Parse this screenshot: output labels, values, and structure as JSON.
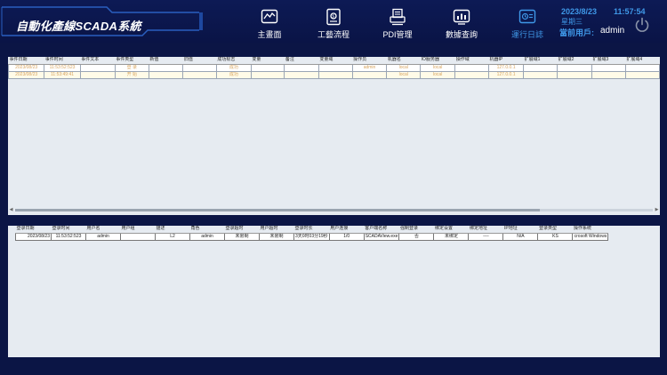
{
  "app": {
    "title": "自動化產線SCADA系統"
  },
  "nav": [
    {
      "label": "主畫面",
      "icon": "chart-monitor-icon"
    },
    {
      "label": "工藝流程",
      "icon": "process-flow-icon"
    },
    {
      "label": "PDI管理",
      "icon": "pdi-printer-icon"
    },
    {
      "label": "數據查詢",
      "icon": "data-query-icon"
    },
    {
      "label": "運行日誌",
      "icon": "operation-log-icon"
    }
  ],
  "status": {
    "date": "2023/8/23",
    "time": "11:57:54",
    "weekday": "星期三",
    "user_label": "當前用戶:",
    "user_name": "admin"
  },
  "colors": {
    "accent": "#3f98e8",
    "header_bg": "#0d1a55",
    "panel_bg": "#e6ebf1",
    "event_text": "#d8a560"
  },
  "event_table": {
    "columns": [
      "事件日期",
      "事件时间",
      "事件文本",
      "事件类型",
      "新值",
      "旧值",
      "成功标志",
      "变量",
      "备注",
      "变量域",
      "操作员",
      "机器名",
      "IO服务器",
      "操作域",
      "机器IP",
      "扩展域1",
      "扩展域2",
      "扩展域3",
      "扩展域4"
    ],
    "rows": [
      [
        "2023/08/23",
        "11:53:52:523",
        "",
        "登 录",
        "",
        "",
        "成功",
        "",
        "",
        "",
        "admin",
        "local",
        "local",
        "",
        "127.0.0.1",
        "",
        "",
        "",
        ""
      ],
      [
        "2023/08/23",
        "11:53:49:41",
        "",
        "开 始",
        "",
        "",
        "成功",
        "",
        "",
        "",
        "",
        "local",
        "local",
        "",
        "127.0.0.1",
        "",
        "",
        "",
        ""
      ]
    ]
  },
  "login_table": {
    "columns": [
      "登录日期",
      "登录时间",
      "用户名",
      "用户组",
      "描述",
      "角色",
      "登录超时",
      "用户超时",
      "登录时长",
      "用户连接",
      "客户端名称",
      "强制登录",
      "绑定设置",
      "绑定地址",
      "IP地址",
      "登录类型",
      "操作系统"
    ],
    "rows": [
      [
        "2023/08/23",
        "11:53:52:523",
        "admin",
        "",
        "L2",
        "admin",
        "未限制",
        "未限制",
        "3天0时03分19秒",
        "1/0",
        "SCADAView.exe",
        "否",
        "未绑定",
        "----",
        "N/A",
        "KS",
        "crosoft Windows"
      ]
    ]
  }
}
